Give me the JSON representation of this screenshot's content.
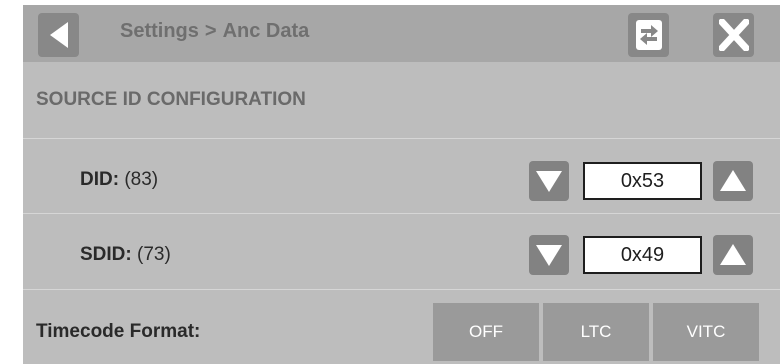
{
  "header": {
    "breadcrumb_parent": "Settings",
    "breadcrumb_separator": ">",
    "breadcrumb_current": "Anc Data",
    "back_icon": "back-arrow-icon",
    "swap_icon": "swap-arrows-icon",
    "close_icon": "close-x-icon"
  },
  "section": {
    "title": "SOURCE ID CONFIGURATION"
  },
  "did": {
    "label": "DID:",
    "decimal": "(83)",
    "value": "0x53"
  },
  "sdid": {
    "label": "SDID:",
    "decimal": "(73)",
    "value": "0x49"
  },
  "timecode": {
    "label": "Timecode Format:",
    "options": [
      "OFF",
      "LTC",
      "VITC"
    ]
  },
  "colors": {
    "header_bg": "#a7a7a7",
    "panel_bg": "#bdbdbd",
    "button_bg": "#888888",
    "segment_bg": "#9a9a9a"
  }
}
